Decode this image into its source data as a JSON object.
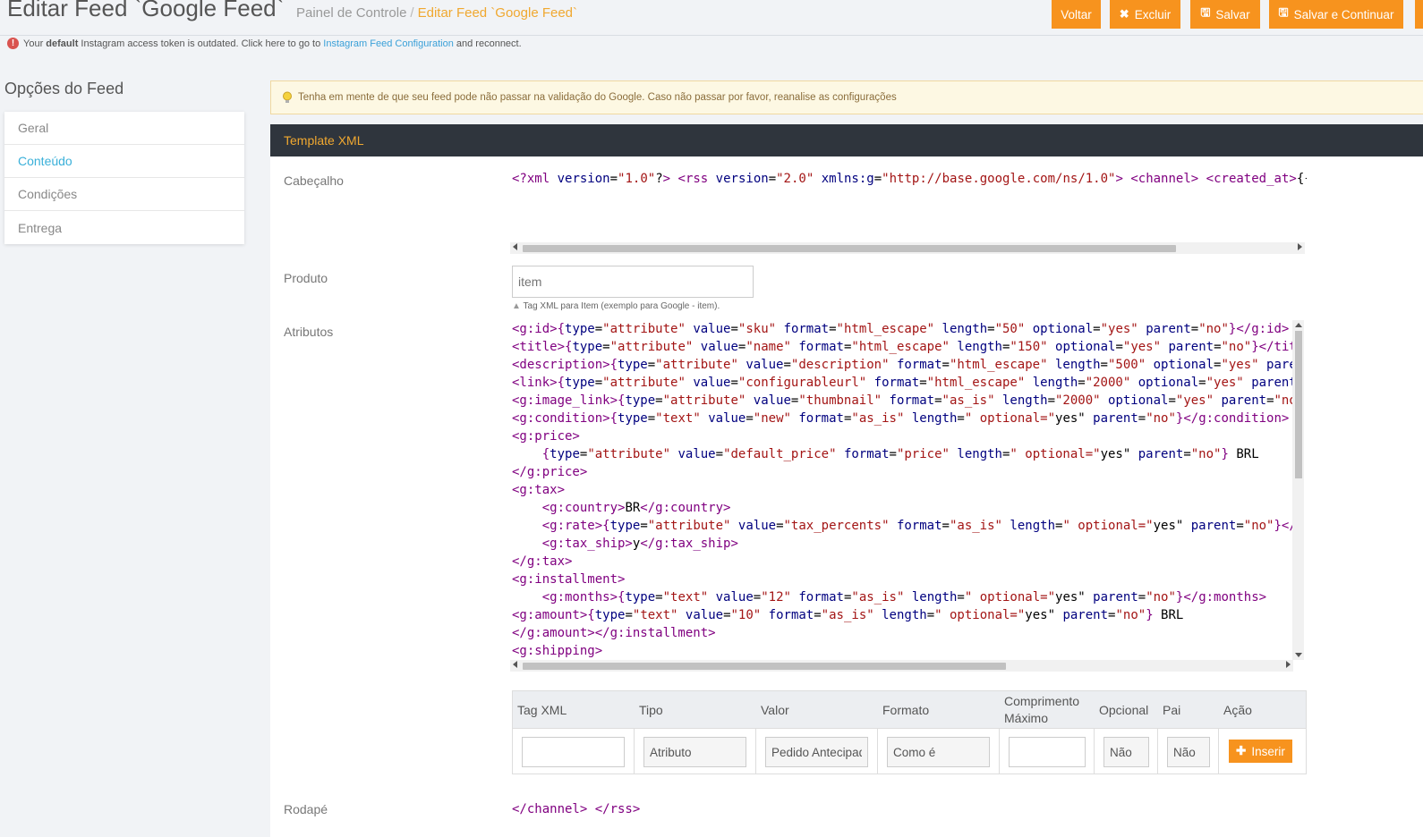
{
  "header": {
    "title": "Editar Feed `Google Feed`",
    "breadcrumb_home": "Painel de Controle",
    "breadcrumb_sep": "/",
    "breadcrumb_current": "Editar Feed `Google Feed`"
  },
  "toolbar": {
    "voltar": "Voltar",
    "excluir": "Excluir",
    "salvar": "Salvar",
    "salvar_continuar": "Salvar e Continuar"
  },
  "notice": {
    "before_bold": "Your",
    "bold": "default",
    "middle": "Instagram access token is outdated. Click here to go to",
    "link": "Instagram Feed Configuration",
    "after": "and reconnect."
  },
  "sidebar": {
    "title": "Opções do Feed",
    "items": [
      {
        "label": "Geral"
      },
      {
        "label": "Conteúdo"
      },
      {
        "label": "Condições"
      },
      {
        "label": "Entrega"
      }
    ]
  },
  "tip": "Tenha em mente de que seu feed pode não passar na validação do Google. Caso não passar por favor, reanalise as configurações",
  "panel": {
    "title": "Template XML",
    "labels": {
      "cabecalho": "Cabeçalho",
      "produto": "Produto",
      "atributos": "Atributos",
      "rodape": "Rodapé"
    },
    "header_code": "<?xml version=\"1.0\"?> <rss version=\"2.0\" xmlns:g=\"http://base.google.com/ns/1.0\"> <channel> <created_at>{{",
    "produto_placeholder": "item",
    "produto_help": "Tag XML para Item (exemplo para Google - item).",
    "attributes_code": [
      "<g:id>{type=\"attribute\" value=\"sku\" format=\"html_escape\" length=\"50\" optional=\"yes\" parent=\"no\"}</g:id>",
      "<title>{type=\"attribute\" value=\"name\" format=\"html_escape\" length=\"150\" optional=\"yes\" parent=\"no\"}</title>",
      "<description>{type=\"attribute\" value=\"description\" format=\"html_escape\" length=\"500\" optional=\"yes\" parent=\"no\"}</description>",
      "<link>{type=\"attribute\" value=\"configurableurl\" format=\"html_escape\" length=\"2000\" optional=\"yes\" parent=\"no\"}</link>",
      "<g:image_link>{type=\"attribute\" value=\"thumbnail\" format=\"as_is\" length=\"2000\" optional=\"yes\" parent=\"no\"}</g:image_link>",
      "<g:condition>{type=\"text\" value=\"new\" format=\"as_is\" length=\"\" optional=\"yes\" parent=\"no\"}</g:condition>",
      "<g:price>",
      "    {type=\"attribute\" value=\"default_price\" format=\"price\" length=\"\" optional=\"yes\" parent=\"no\"} BRL",
      "</g:price>",
      "<g:tax>",
      "    <g:country>BR</g:country>",
      "    <g:rate>{type=\"attribute\" value=\"tax_percents\" format=\"as_is\" length=\"\" optional=\"yes\" parent=\"no\"}</g:rate>",
      "    <g:tax_ship>y</g:tax_ship>",
      "</g:tax>",
      "<g:installment>",
      "    <g:months>{type=\"text\" value=\"12\" format=\"as_is\" length=\"\" optional=\"yes\" parent=\"no\"}</g:months>",
      "<g:amount>{type=\"text\" value=\"10\" format=\"as_is\" length=\"\" optional=\"yes\" parent=\"no\"} BRL",
      "</g:amount></g:installment>",
      "<g:shipping>"
    ],
    "table": {
      "headers": [
        "Tag XML",
        "Tipo",
        "Valor",
        "Formato",
        "Comprimento Máximo",
        "Opcional",
        "Pai",
        "Ação"
      ],
      "row": {
        "tag": "",
        "tipo": "Atributo",
        "valor": "Pedido Antecipado",
        "formato": "Como é",
        "comprimento": "",
        "opcional": "Não",
        "pai": "Não"
      },
      "insert_label": "Inserir"
    },
    "footer_code": "</channel> </rss>"
  },
  "colors": {
    "accent": "#f7931e",
    "link": "#3aa0d8",
    "panel_head": "#2f353d"
  }
}
